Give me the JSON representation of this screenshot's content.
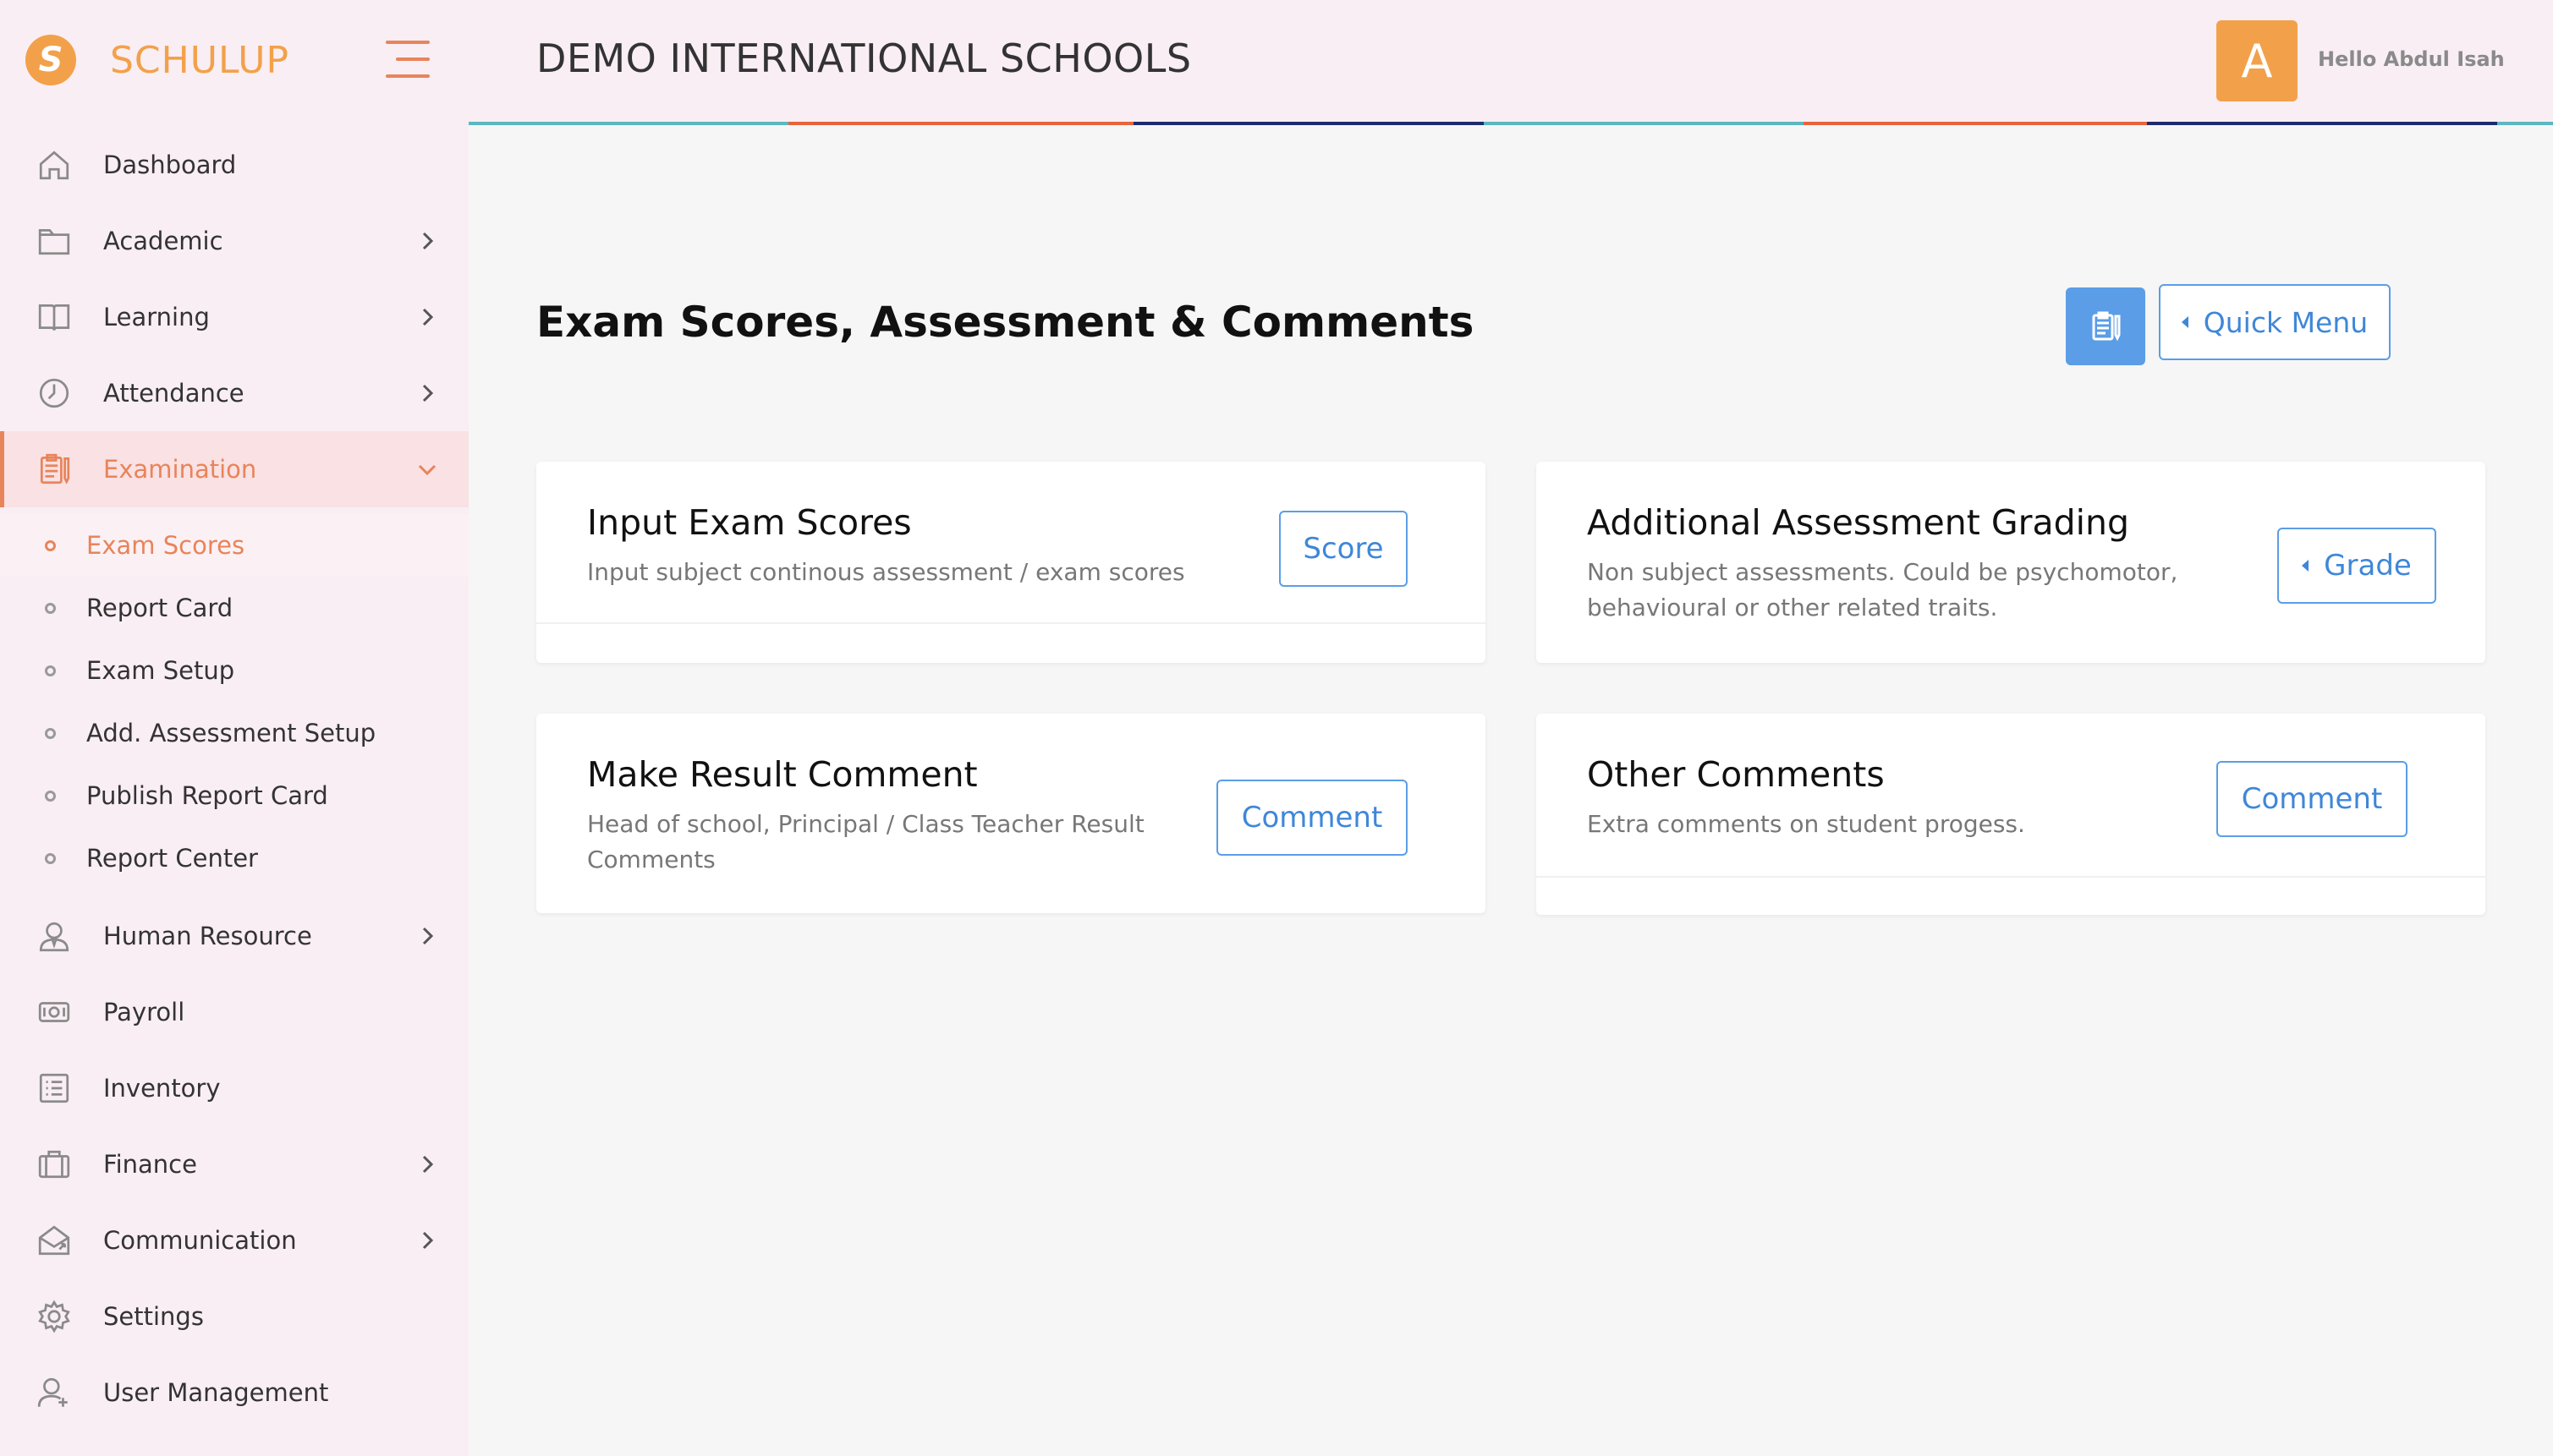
{
  "brand": {
    "logo_letter": "S",
    "name": "SCHULUP"
  },
  "header": {
    "school_name": "DEMO INTERNATIONAL SCHOOLS",
    "avatar_letter": "A",
    "greeting": "Hello Abdul Isah"
  },
  "colors": {
    "accent": "#e8845a",
    "brand": "#f2a14a",
    "primary_blue": "#5b9de6",
    "sidebar_bg": "#f9eef3",
    "line_teal": "#5cb8c0",
    "line_orange": "#e8643a",
    "line_navy": "#1e2a6e"
  },
  "sidebar": {
    "items": [
      {
        "label": "Dashboard",
        "icon": "home-icon"
      },
      {
        "label": "Academic",
        "icon": "folder-icon"
      },
      {
        "label": "Learning",
        "icon": "book-icon"
      },
      {
        "label": "Attendance",
        "icon": "clock-icon"
      },
      {
        "label": "Examination",
        "icon": "clipboard-icon"
      },
      {
        "label": "Human Resource",
        "icon": "user-tie-icon"
      },
      {
        "label": "Payroll",
        "icon": "cash-icon"
      },
      {
        "label": "Inventory",
        "icon": "list-icon"
      },
      {
        "label": "Finance",
        "icon": "briefcase-icon"
      },
      {
        "label": "Communication",
        "icon": "mail-icon"
      },
      {
        "label": "Settings",
        "icon": "gear-icon"
      },
      {
        "label": "User Management",
        "icon": "user-add-icon"
      }
    ],
    "examination_sub": [
      {
        "label": "Exam Scores"
      },
      {
        "label": "Report Card"
      },
      {
        "label": "Exam Setup"
      },
      {
        "label": "Add. Assessment Setup"
      },
      {
        "label": "Publish Report Card"
      },
      {
        "label": "Report Center"
      }
    ]
  },
  "main": {
    "title": "Exam Scores, Assessment & Comments",
    "quick_menu_label": "Quick Menu",
    "cards": [
      {
        "title": "Input Exam Scores",
        "desc": "Input subject continous assessment / exam scores",
        "button": "Score"
      },
      {
        "title": "Additional Assessment Grading",
        "desc_line1": "Non subject assessments. Could be psychomotor,",
        "desc_line2": "behavioural or other related traits.",
        "button": "Grade"
      },
      {
        "title": "Make Result Comment",
        "desc_line1": "Head of school, Principal / Class Teacher Result",
        "desc_line2": "Comments",
        "button": "Comment"
      },
      {
        "title": "Other Comments",
        "desc": "Extra comments on student progess.",
        "button": "Comment"
      }
    ]
  }
}
